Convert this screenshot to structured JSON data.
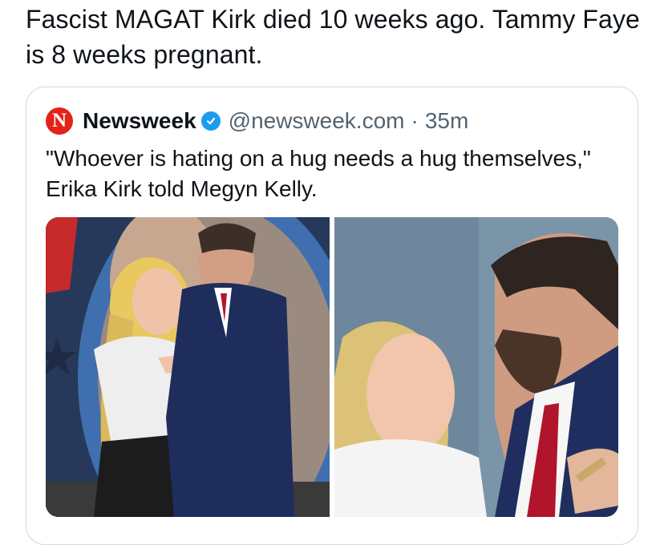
{
  "post": {
    "text": "Fascist MAGAT Kirk died 10 weeks ago. Tammy Faye is 8 weeks pregnant."
  },
  "quote": {
    "logo_letter": "N",
    "source_name": "Newsweek",
    "verified_icon": "verified-badge-icon",
    "handle": "@newsweek.com",
    "separator": "·",
    "age": "35m",
    "text": "\"Whoever is hating on a hug needs a hug themselves,\" Erika Kirk told Megyn Kelly."
  },
  "colors": {
    "brand_red": "#e2231a",
    "verified_blue": "#1d9bf0",
    "muted_text": "#536471",
    "border": "#cfd9de"
  }
}
